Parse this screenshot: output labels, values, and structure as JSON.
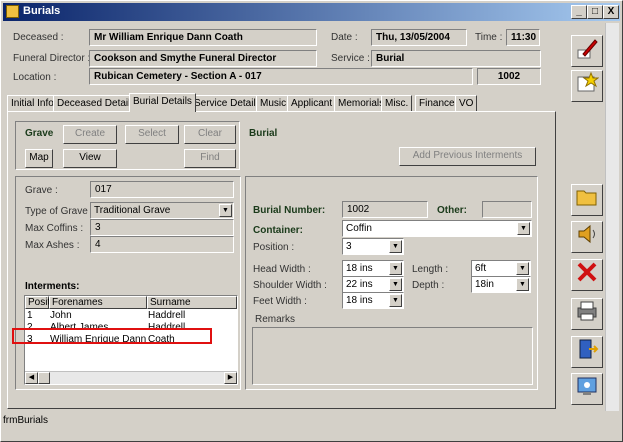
{
  "window": {
    "title": "Burials",
    "min": "_",
    "max": "□",
    "close": "X"
  },
  "header": {
    "deceased_label": "Deceased :",
    "deceased": "Mr William Enrique Dann Coath",
    "date_label": "Date :",
    "date": "Thu, 13/05/2004",
    "time_label": "Time :",
    "time": "11:30",
    "fd_label": "Funeral Director :",
    "fd": "Cookson and Smythe Funeral Director",
    "service_label": "Service :",
    "service": "Burial",
    "location_label": "Location :",
    "location": "Rubican Cemetery - Section A - 017",
    "location_num": "1002"
  },
  "tabs": [
    "Initial Info",
    "Deceased Details",
    "Burial Details",
    "Service Details",
    "Music",
    "Applicant",
    "Memorials",
    "Misc.",
    "Finance",
    "VO"
  ],
  "grave_group": {
    "title": "Grave",
    "create": "Create",
    "select": "Select",
    "clear": "Clear",
    "map": "Map",
    "view": "View",
    "find": "Find"
  },
  "burial_group": {
    "title": "Burial",
    "add_prev": "Add Previous Interments"
  },
  "grave_info": {
    "grave_label": "Grave :",
    "grave": "017",
    "type_label": "Type of Grave",
    "type": "Traditional Grave",
    "coffins_label": "Max Coffins :",
    "coffins": "3",
    "ashes_label": "Max Ashes :",
    "ashes": "4",
    "interments_label": "Interments:"
  },
  "interments": {
    "headers": [
      "Posit",
      "Forenames",
      "Surname"
    ],
    "rows": [
      {
        "pos": "1",
        "fore": "John",
        "sur": "Haddrell"
      },
      {
        "pos": "2",
        "fore": "Albert James",
        "sur": "Haddrell"
      },
      {
        "pos": "3",
        "fore": "William Enrique Dann",
        "sur": "Coath"
      }
    ]
  },
  "burial": {
    "num_label": "Burial Number:",
    "num": "1002",
    "other_label": "Other:",
    "other": "",
    "container_label": "Container:",
    "container": "Coffin",
    "position_label": "Position :",
    "position": "3",
    "head_label": "Head Width :",
    "head": "18 ins",
    "length_label": "Length :",
    "length": "6ft",
    "shoulder_label": "Shoulder Width :",
    "shoulder": "22 ins",
    "depth_label": "Depth :",
    "depth": "18in",
    "feet_label": "Feet Width :",
    "feet": "18 ins",
    "remarks_label": "Remarks"
  },
  "status": "frmBurials"
}
